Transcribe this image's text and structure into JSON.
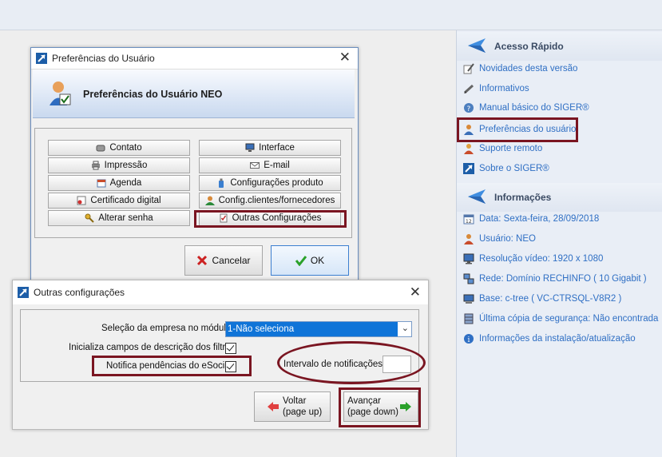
{
  "right_panel": {
    "quick_access": {
      "title": "Acesso Rápido",
      "items": [
        {
          "label": "Novidades desta versão",
          "icon": "document-pen-icon"
        },
        {
          "label": "Informativos",
          "icon": "pen-icon"
        },
        {
          "label": "Manual básico do SIGER®",
          "icon": "help-icon"
        },
        {
          "label": "Preferências do usuário",
          "icon": "user-icon"
        },
        {
          "label": "Suporte remoto",
          "icon": "support-icon"
        },
        {
          "label": "Sobre o SIGER®",
          "icon": "app-arrow-icon"
        }
      ]
    },
    "info": {
      "title": "Informações",
      "items": [
        {
          "label": "Data: Sexta-feira, 28/09/2018",
          "icon": "calendar-icon"
        },
        {
          "label": "Usuário: NEO",
          "icon": "user-icon"
        },
        {
          "label": "Resolução vídeo:  1920 x 1080",
          "icon": "monitor-icon"
        },
        {
          "label": "Rede: Domínio RECHINFO ( 10 Gigabit )",
          "icon": "network-icon"
        },
        {
          "label": "Base:  c-tree  ( VC-CTRSQL-V8R2 )",
          "icon": "computer-icon"
        },
        {
          "label": "Última cópia de segurança: Não encontrada",
          "icon": "database-icon"
        },
        {
          "label": "Informações da instalação/atualização",
          "icon": "info-icon"
        }
      ]
    }
  },
  "prefs_dialog": {
    "title": "Preferências do Usuário",
    "banner_title": "Preferências do Usuário NEO",
    "buttons": [
      "Contato",
      "Interface",
      "Impressão",
      "E-mail",
      "Agenda",
      "Configurações produto",
      "Certificado digital",
      "Config.clientes/fornecedores",
      "Alterar senha",
      "Outras Configurações"
    ],
    "cancel_label": "Cancelar",
    "ok_label": "OK"
  },
  "other_dialog": {
    "title": "Outras configurações",
    "company_label": "Seleção da empresa no módulo",
    "company_value": "1-Não seleciona",
    "init_fields_label": "Inicializa campos de descrição dos filtros",
    "init_fields_checked": true,
    "esocial_label": "Notifica pendências do eSocial",
    "esocial_checked": true,
    "interval_label": "Intervalo de notificações",
    "interval_value": "",
    "back_label": "Voltar",
    "back_hint": "(page up)",
    "next_label": "Avançar",
    "next_hint": "(page down)"
  },
  "colors": {
    "highlight": "#7a1521",
    "link": "#2f6fc4",
    "selection": "#0f74d8"
  }
}
